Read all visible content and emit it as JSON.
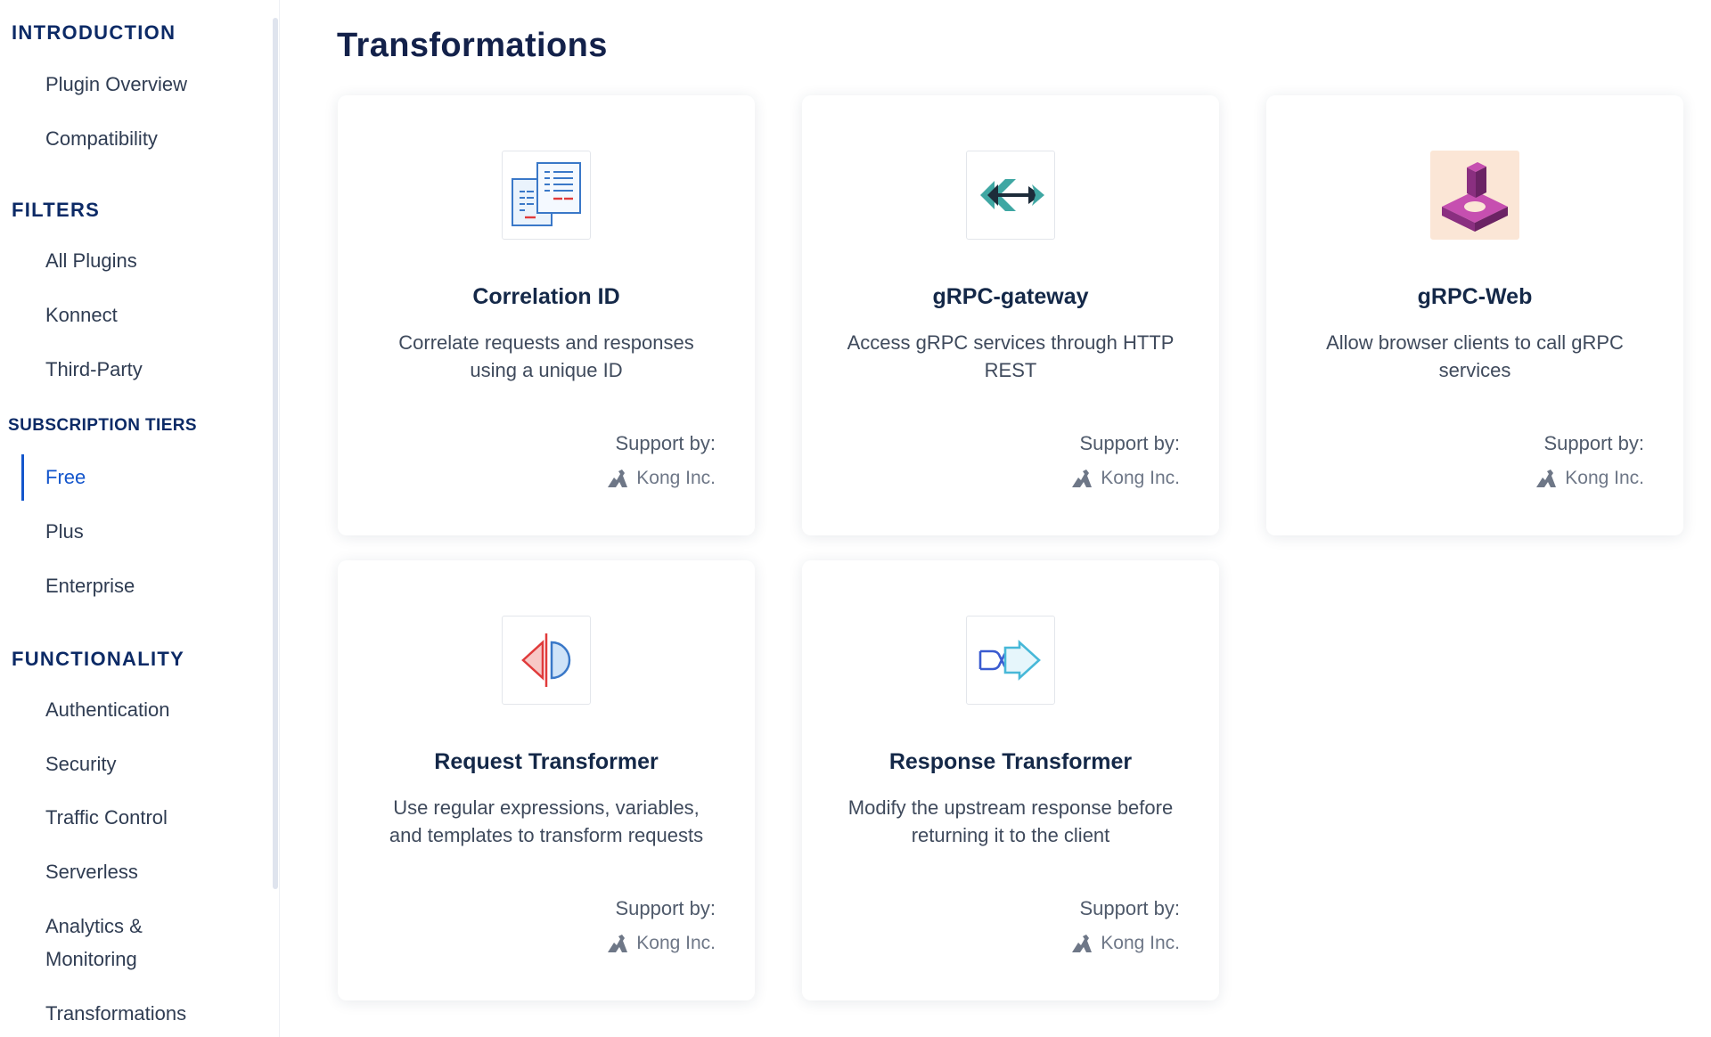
{
  "sidebar": {
    "sections": {
      "introduction": "INTRODUCTION",
      "filters": "FILTERS",
      "subscription_tiers": "SUBSCRIPTION TIERS",
      "functionality": "FUNCTIONALITY"
    },
    "introduction_items": [
      "Plugin Overview",
      "Compatibility"
    ],
    "filter_items": [
      "All Plugins",
      "Konnect",
      "Third-Party"
    ],
    "tier_items": [
      "Free",
      "Plus",
      "Enterprise"
    ],
    "active_item": "Free",
    "functionality_items": [
      "Authentication",
      "Security",
      "Traffic Control",
      "Serverless",
      "Analytics &",
      "Monitoring",
      "Transformations"
    ]
  },
  "main": {
    "title": "Transformations",
    "support_label": "Support by:",
    "cards": [
      {
        "title": "Correlation ID",
        "desc1": "Correlate requests and responses",
        "desc2": "using a unique ID",
        "vendor": "Kong Inc.",
        "icon": "correlation-id-icon"
      },
      {
        "title": "gRPC-gateway",
        "desc1": "Access gRPC services through HTTP",
        "desc2": "REST",
        "vendor": "Kong Inc.",
        "icon": "grpc-gateway-icon"
      },
      {
        "title": "gRPC-Web",
        "desc1": "Allow browser clients to call gRPC",
        "desc2": "services",
        "vendor": "Kong Inc.",
        "icon": "grpc-web-icon"
      },
      {
        "title": "Request Transformer",
        "desc1": "Use regular expressions, variables,",
        "desc2": "and templates to transform requests",
        "vendor": "Kong Inc.",
        "icon": "request-transformer-icon"
      },
      {
        "title": "Response Transformer",
        "desc1": "Modify the upstream response before",
        "desc2": "returning it to the client",
        "vendor": "Kong Inc.",
        "icon": "response-transformer-icon"
      }
    ]
  },
  "colors": {
    "heading": "#0c2a66",
    "active": "#1456cc",
    "title": "#13214a"
  }
}
